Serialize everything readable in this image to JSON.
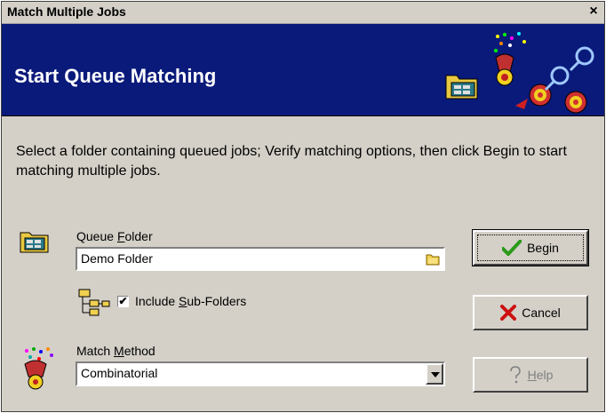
{
  "window": {
    "title": "Match Multiple Jobs",
    "close_symbol": "×"
  },
  "banner": {
    "heading": "Start Queue Matching",
    "icons": [
      "folder-icon",
      "match-target-icon"
    ]
  },
  "instructions": "Select a folder containing queued jobs;  Verify matching options, then click Begin to start matching multiple jobs.",
  "queue_folder": {
    "label_pre": "Queue ",
    "label_accel": "F",
    "label_post": "older",
    "value": "Demo Folder",
    "icon": "folder-icon"
  },
  "subfolders": {
    "checked": true,
    "check_mark": "✔",
    "label_pre": "Include ",
    "label_accel": "S",
    "label_post": "ub-Folders",
    "icon": "folder-tree-icon"
  },
  "match_method": {
    "label_pre": "Match ",
    "label_accel": "M",
    "label_post": "ethod",
    "selected": "Combinatorial",
    "icon": "match-target-icon"
  },
  "buttons": {
    "begin": "Begin",
    "cancel": "Cancel",
    "help_accel": "H",
    "help_post": "elp",
    "help_enabled": false
  },
  "colors": {
    "banner_bg": "#0a1a7a",
    "dialog_bg": "#d4d0c8",
    "begin_check": "#2a9a1a",
    "cancel_x": "#cc1010"
  }
}
